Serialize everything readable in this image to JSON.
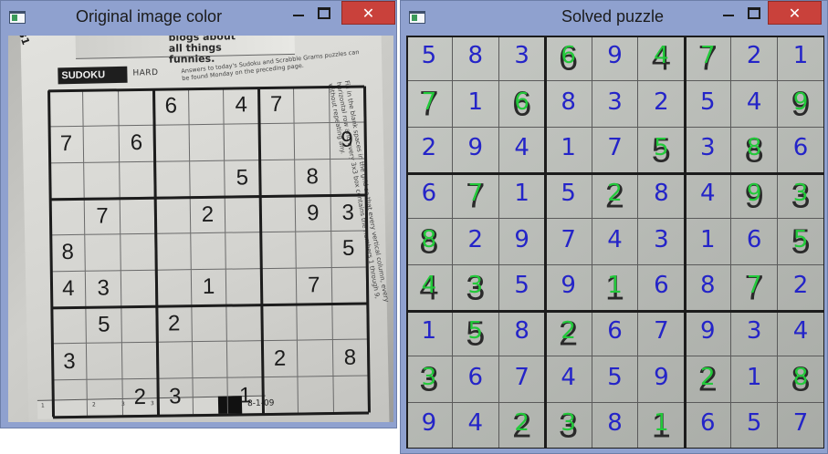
{
  "windows": {
    "original": {
      "title": "Original image color"
    },
    "solved": {
      "title": "Solved puzzle"
    },
    "controls": {
      "close": "✕"
    }
  },
  "photo": {
    "page_corner": "31",
    "cartoon_caption": "blogs about all things funnies.",
    "banner_title": "SUDOKU",
    "banner_level": "HARD",
    "banner_note": "Answers to today's Sudoku and Scrabble Grams puzzles can be found Monday on the preceding page.",
    "instructions": "Fill in the blank spaces in the grid so that every vertical column, every horizontal row and every 3x3 box contains the numbers 1 through 9, without repeating any.",
    "strip_labels": [
      "1",
      "2",
      "3",
      "3"
    ],
    "date": "8-1-09"
  },
  "colors": {
    "given_overlay": "#22c93a",
    "solved_digit": "#2424c8",
    "close_button": "#c9413b",
    "window_frame": "#8fa1cf"
  },
  "puzzle": {
    "given": [
      [
        0,
        0,
        0,
        6,
        0,
        4,
        7,
        0,
        0
      ],
      [
        7,
        0,
        6,
        0,
        0,
        0,
        0,
        0,
        9
      ],
      [
        0,
        0,
        0,
        0,
        0,
        5,
        0,
        8,
        0
      ],
      [
        0,
        7,
        0,
        0,
        2,
        0,
        0,
        9,
        3
      ],
      [
        8,
        0,
        0,
        0,
        0,
        0,
        0,
        0,
        5
      ],
      [
        4,
        3,
        0,
        0,
        1,
        0,
        0,
        7,
        0
      ],
      [
        0,
        5,
        0,
        2,
        0,
        0,
        0,
        0,
        0
      ],
      [
        3,
        0,
        0,
        0,
        0,
        0,
        2,
        0,
        8
      ],
      [
        0,
        0,
        2,
        3,
        0,
        1,
        0,
        0,
        0
      ]
    ],
    "solution": [
      [
        5,
        8,
        3,
        6,
        9,
        4,
        7,
        2,
        1
      ],
      [
        7,
        1,
        6,
        8,
        3,
        2,
        5,
        4,
        9
      ],
      [
        2,
        9,
        4,
        1,
        7,
        5,
        3,
        8,
        6
      ],
      [
        6,
        7,
        1,
        5,
        2,
        8,
        4,
        9,
        3
      ],
      [
        8,
        2,
        9,
        7,
        4,
        3,
        1,
        6,
        5
      ],
      [
        4,
        3,
        5,
        9,
        1,
        6,
        8,
        7,
        2
      ],
      [
        1,
        5,
        8,
        2,
        6,
        7,
        9,
        3,
        4
      ],
      [
        3,
        6,
        7,
        4,
        5,
        9,
        2,
        1,
        8
      ],
      [
        9,
        4,
        2,
        3,
        8,
        1,
        6,
        5,
        7
      ]
    ]
  }
}
